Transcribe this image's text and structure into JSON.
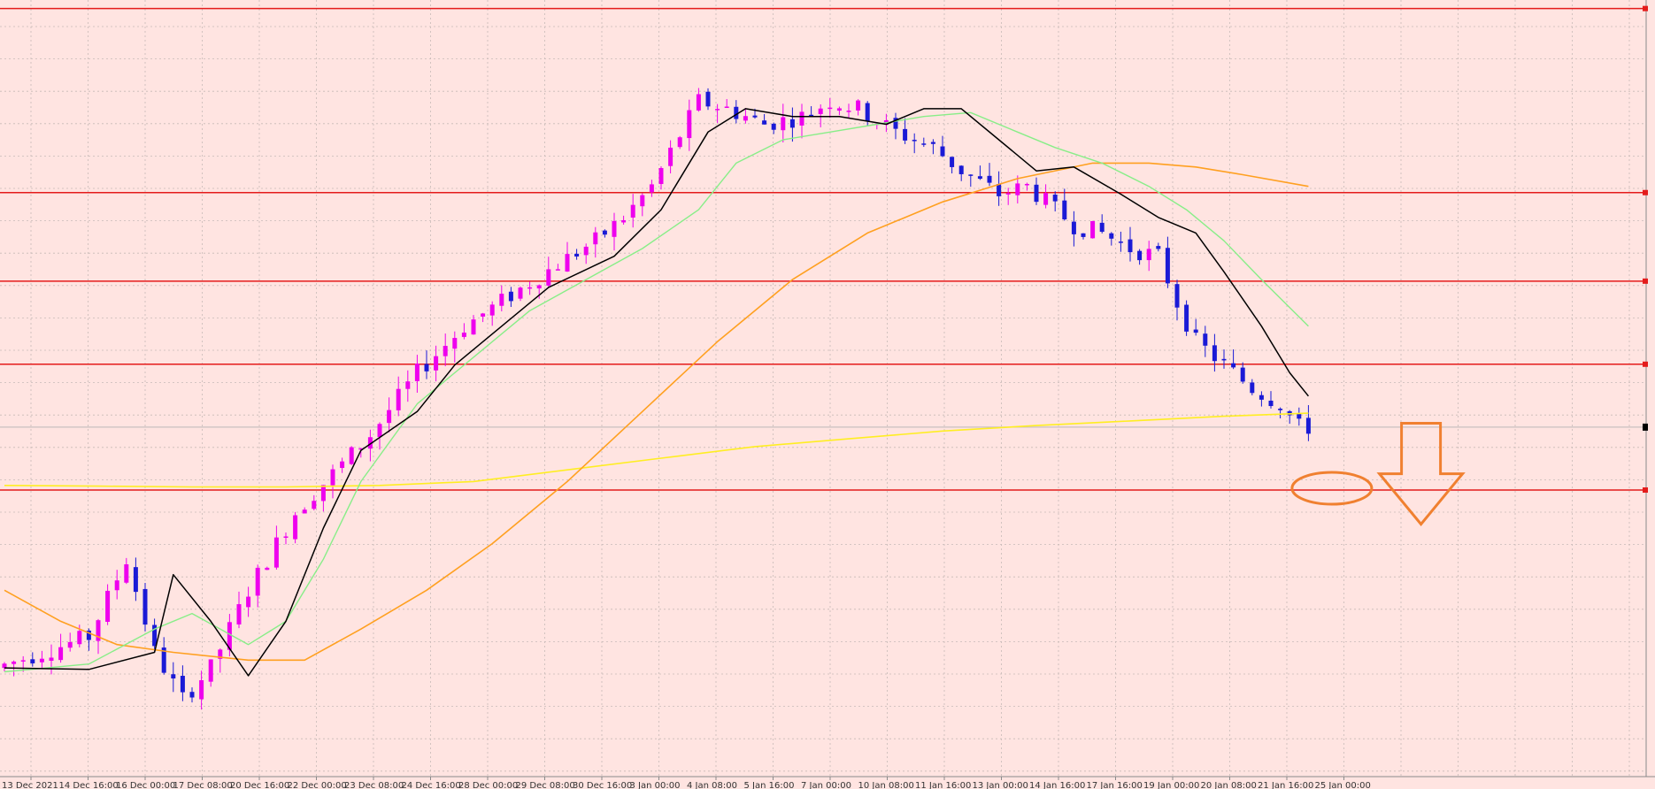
{
  "chart_data": {
    "type": "candlestick",
    "title": "",
    "xlabel": "",
    "ylabel": "",
    "ylim": [
      0,
      100
    ],
    "grid": true,
    "colors": {
      "background": "#ffe4e1",
      "grid": "#c7b9b7",
      "bull_candle": "#ee00ee",
      "bear_candle": "#1a1ad6",
      "level_line": "#e41b1b",
      "ma_fast": "#000000",
      "ma_medium": "#88ee88",
      "ma_slow": "#ffa020",
      "ma_long": "#ffee22",
      "annotation": "#f08030",
      "current_price_line": "#c8c0c0"
    },
    "x_tick_labels": [
      "13 Dec 2021",
      "14 Dec 16:00",
      "16 Dec 00:00",
      "17 Dec 08:00",
      "20 Dec 16:00",
      "22 Dec 00:00",
      "23 Dec 08:00",
      "24 Dec 16:00",
      "28 Dec 00:00",
      "29 Dec 08:00",
      "30 Dec 16:00",
      "3 Jan 00:00",
      "4 Jan 08:00",
      "5 Jan 16:00",
      "7 Jan 00:00",
      "10 Jan 08:00",
      "11 Jan 16:00",
      "13 Jan 00:00",
      "14 Jan 16:00",
      "17 Jan 16:00",
      "19 Jan 00:00",
      "20 Jan 08:00",
      "21 Jan 16:00",
      "25 Jan 00:00"
    ],
    "horizontal_levels": [
      98.9,
      75.2,
      63.8,
      53.1,
      36.9
    ],
    "current_price": 45.0,
    "candle_anchors": [
      [
        0,
        14
      ],
      [
        5,
        16
      ],
      [
        10,
        18
      ],
      [
        14,
        28
      ],
      [
        17,
        16
      ],
      [
        20,
        10
      ],
      [
        23,
        14
      ],
      [
        27,
        24
      ],
      [
        32,
        34
      ],
      [
        36,
        39
      ],
      [
        40,
        44
      ],
      [
        45,
        52
      ],
      [
        50,
        58
      ],
      [
        55,
        62
      ],
      [
        60,
        66
      ],
      [
        64,
        69
      ],
      [
        67,
        72
      ],
      [
        70,
        76
      ],
      [
        75,
        87
      ],
      [
        78,
        86
      ],
      [
        82,
        84
      ],
      [
        86,
        85
      ],
      [
        89,
        87
      ],
      [
        92,
        86
      ],
      [
        96,
        83
      ],
      [
        100,
        81
      ],
      [
        103,
        78
      ],
      [
        107,
        75
      ],
      [
        110,
        76
      ],
      [
        113,
        73
      ],
      [
        115,
        71
      ],
      [
        118,
        70
      ],
      [
        121,
        68
      ],
      [
        124,
        67
      ],
      [
        126,
        61
      ],
      [
        128,
        56
      ],
      [
        131,
        53
      ],
      [
        134,
        50
      ],
      [
        137,
        48
      ],
      [
        139,
        45
      ]
    ],
    "ma_fast": [
      [
        0,
        14
      ],
      [
        9,
        13.8
      ],
      [
        16,
        16
      ],
      [
        18,
        26
      ],
      [
        22,
        20
      ],
      [
        26,
        13
      ],
      [
        30,
        20
      ],
      [
        34,
        32
      ],
      [
        38,
        42
      ],
      [
        44,
        47
      ],
      [
        48,
        53
      ],
      [
        53,
        58
      ],
      [
        58,
        63
      ],
      [
        65,
        67
      ],
      [
        70,
        73
      ],
      [
        75,
        83
      ],
      [
        79,
        86
      ],
      [
        84,
        85
      ],
      [
        89,
        85
      ],
      [
        94,
        84
      ],
      [
        98,
        86
      ],
      [
        102,
        86
      ],
      [
        106,
        82
      ],
      [
        110,
        78
      ],
      [
        114,
        78.5
      ],
      [
        119,
        75
      ],
      [
        123,
        72
      ],
      [
        127,
        70
      ],
      [
        130,
        65
      ],
      [
        134,
        58
      ],
      [
        137,
        52
      ],
      [
        139,
        49
      ]
    ],
    "ma_medium": [
      [
        0,
        13.5
      ],
      [
        9,
        14.5
      ],
      [
        16,
        19
      ],
      [
        20,
        21
      ],
      [
        26,
        17
      ],
      [
        30,
        20
      ],
      [
        34,
        28
      ],
      [
        38,
        38
      ],
      [
        44,
        48
      ],
      [
        50,
        54
      ],
      [
        56,
        60
      ],
      [
        62,
        64
      ],
      [
        68,
        68
      ],
      [
        74,
        73
      ],
      [
        78,
        79
      ],
      [
        83,
        82
      ],
      [
        88,
        83
      ],
      [
        93,
        84
      ],
      [
        98,
        85
      ],
      [
        103,
        85.5
      ],
      [
        108,
        83
      ],
      [
        112,
        81
      ],
      [
        117,
        79
      ],
      [
        122,
        76
      ],
      [
        126,
        73
      ],
      [
        130,
        69
      ],
      [
        134,
        64
      ],
      [
        139,
        58
      ]
    ],
    "ma_slow": [
      [
        0,
        24
      ],
      [
        6,
        20
      ],
      [
        12,
        17
      ],
      [
        18,
        16
      ],
      [
        26,
        15
      ],
      [
        32,
        15
      ],
      [
        38,
        19
      ],
      [
        45,
        24
      ],
      [
        52,
        30
      ],
      [
        60,
        38
      ],
      [
        68,
        47
      ],
      [
        76,
        56
      ],
      [
        84,
        64
      ],
      [
        92,
        70
      ],
      [
        100,
        74
      ],
      [
        108,
        77
      ],
      [
        116,
        79
      ],
      [
        122,
        79
      ],
      [
        127,
        78.5
      ],
      [
        132,
        77.5
      ],
      [
        139,
        76
      ]
    ],
    "ma_long": [
      [
        0,
        37.5
      ],
      [
        10,
        37.4
      ],
      [
        20,
        37.3
      ],
      [
        30,
        37.3
      ],
      [
        40,
        37.5
      ],
      [
        50,
        38
      ],
      [
        60,
        39.5
      ],
      [
        70,
        41
      ],
      [
        80,
        42.5
      ],
      [
        90,
        43.5
      ],
      [
        100,
        44.5
      ],
      [
        110,
        45.2
      ],
      [
        120,
        45.8
      ],
      [
        130,
        46.4
      ],
      [
        139,
        46.8
      ]
    ],
    "annotations": [
      {
        "type": "ellipse",
        "x": 141.5,
        "y": 36.9
      },
      {
        "type": "down-arrow",
        "x": 151,
        "y_top": 45.5,
        "y_bottom": 32.5
      }
    ]
  }
}
